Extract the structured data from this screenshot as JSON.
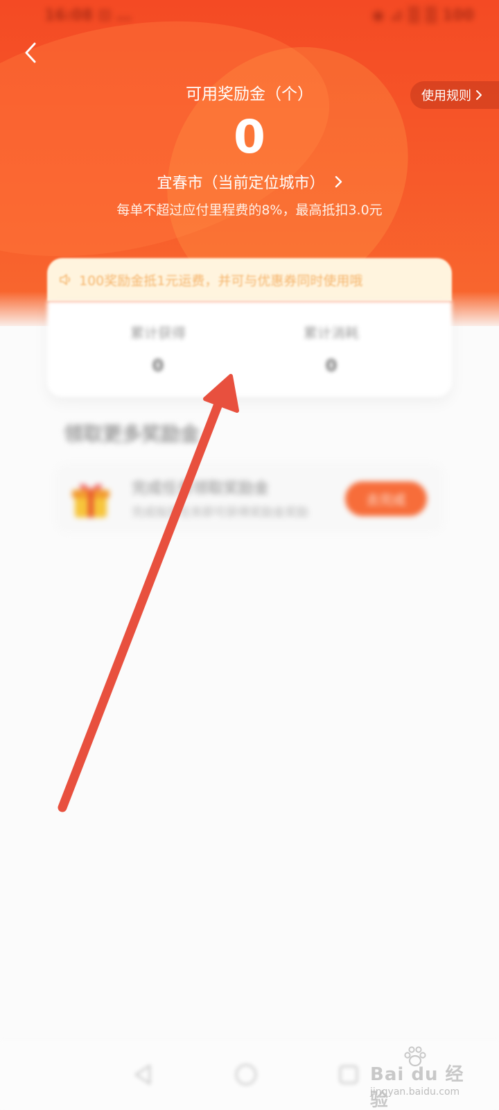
{
  "status_bar": {
    "left_text": "16:08 ⊡ …",
    "right_text": "◉ ⊿ ▒ ▒ 100"
  },
  "header": {
    "back_icon": "chevron-left-icon",
    "rules_label": "使用规则",
    "bonus_title": "可用奖励金（个）",
    "bonus_value": "0",
    "city_label": "宜春市（当前定位城市）",
    "deduct_note": "每单不超过应付里程费的8%，最高抵扣3.0元"
  },
  "notice": {
    "icon": "speaker-icon",
    "text": "100奖励金抵1元运费，并可与优惠券同时使用哦"
  },
  "stats": [
    {
      "label": "累计获得",
      "value": "0"
    },
    {
      "label": "累计消耗",
      "value": "0"
    }
  ],
  "activities": {
    "title": "领取更多奖励金",
    "items": [
      {
        "icon": "gift-icon",
        "name": "完成任务领取奖励金",
        "desc": "完成指定任务即可获得奖励金奖励",
        "button": "去完成"
      }
    ]
  },
  "watermark": {
    "brand": "Bai du 经验",
    "url": "jingyan.baidu.com"
  },
  "colors": {
    "header_top": "#f44a24",
    "header_bottom": "#f8692f",
    "notice_bg": "#fff4de",
    "notice_text": "#f5b46b",
    "arrow": "#e8503e"
  }
}
